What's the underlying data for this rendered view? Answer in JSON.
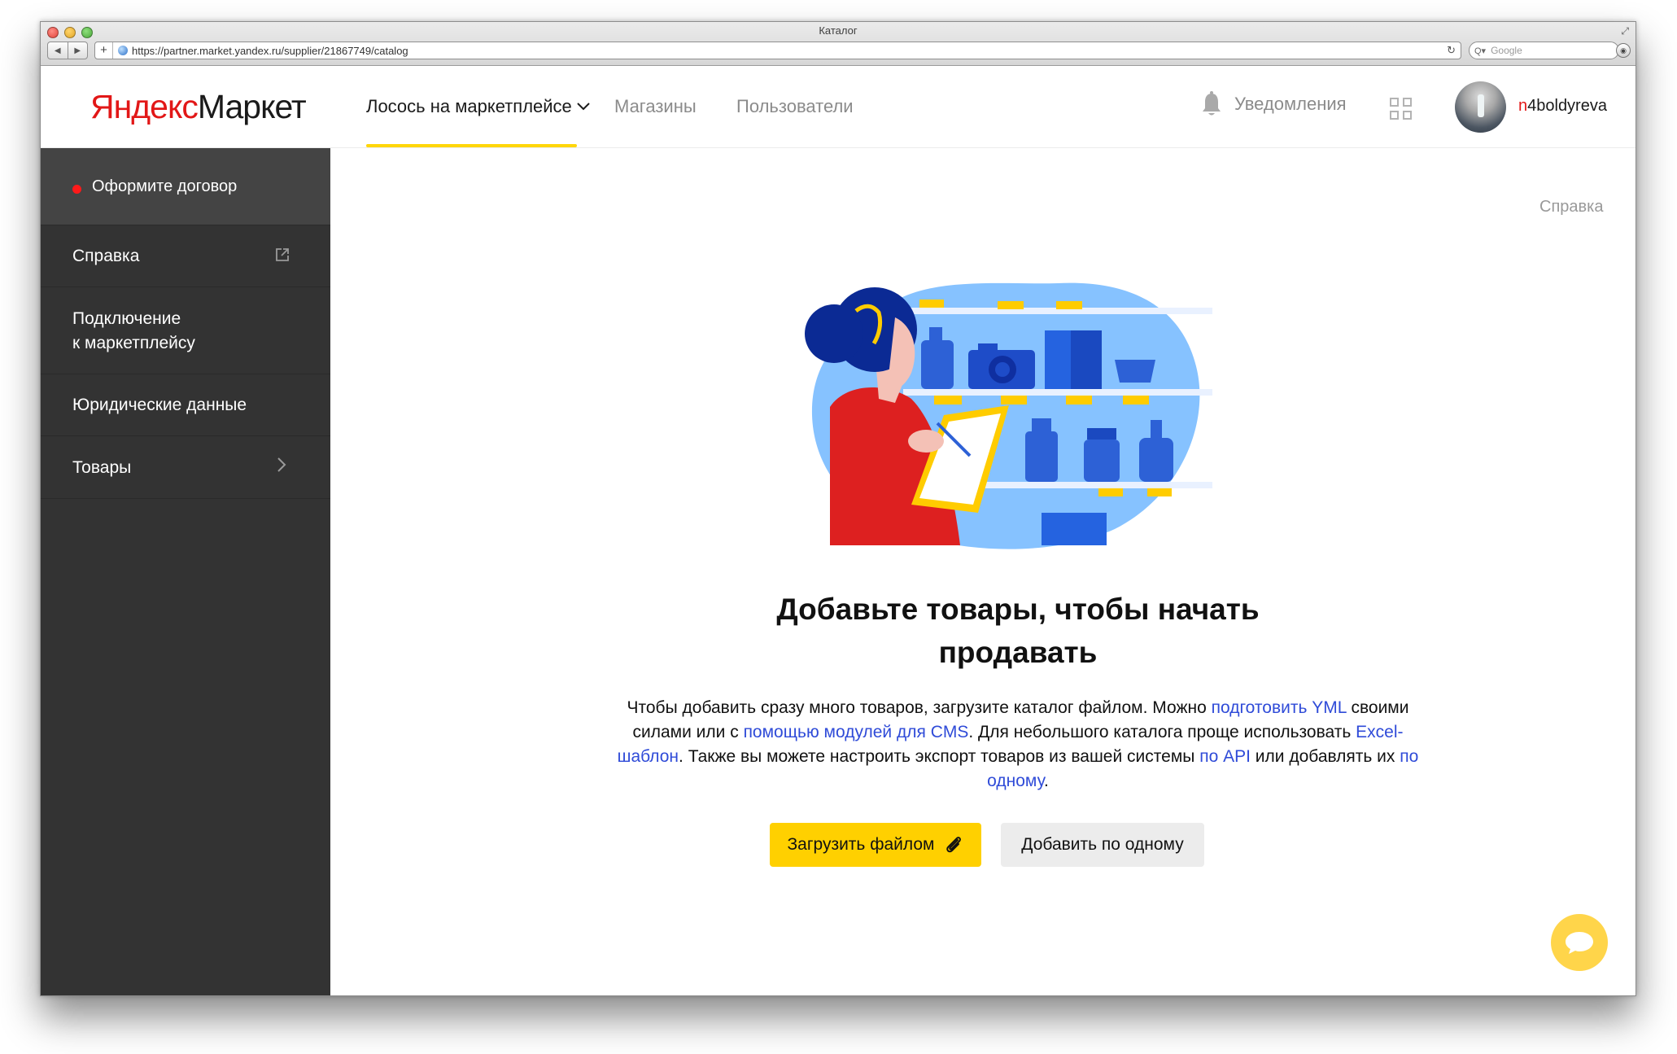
{
  "browser": {
    "window_title": "Каталог",
    "url": "https://partner.market.yandex.ru/supplier/21867749/catalog",
    "search_placeholder": "Google"
  },
  "logo": {
    "part1": "Яндекс",
    "part2": "Маркет"
  },
  "nav": {
    "active": "Лосось на маркетплейсе",
    "shops": "Магазины",
    "users": "Пользователи"
  },
  "header": {
    "notifications": "Уведомления",
    "username_first": "n",
    "username_rest": "4boldyreva"
  },
  "sidebar": {
    "items": [
      {
        "label": "Оформите договор",
        "status_color": "#ff1a1a"
      },
      {
        "label": "Справка",
        "icon": "external-link-icon"
      },
      {
        "label_line1": "Подключение",
        "label_line2": "к маркетплейсу"
      },
      {
        "label": "Юридические данные"
      },
      {
        "label": "Товары",
        "icon": "chevron-right-icon"
      }
    ]
  },
  "main": {
    "help_link": "Справка",
    "title_line1": "Добавьте товары, чтобы начать",
    "title_line2": "продавать",
    "desc": {
      "t1": "Чтобы добавить сразу много товаров, загрузите каталог файлом. Можно ",
      "link_yml": "подготовить YML",
      "t2": " своими силами или с ",
      "link_cms": "помощью модулей для CMS",
      "t3": ". Для небольшого каталога проще использовать ",
      "link_excel": "Excel-шаблон",
      "t4": ". Также вы можете настроить экспорт товаров из вашей системы ",
      "link_api": "по API",
      "t5": " или добавлять их ",
      "link_one": "по одному",
      "t6": "."
    },
    "btn_upload": "Загрузить файлом",
    "btn_add": "Добавить по одному"
  },
  "colors": {
    "accent_yellow": "#ffd000",
    "brand_red": "#e21717",
    "link_blue": "#2f4bd8",
    "sidebar_bg": "#333333"
  }
}
